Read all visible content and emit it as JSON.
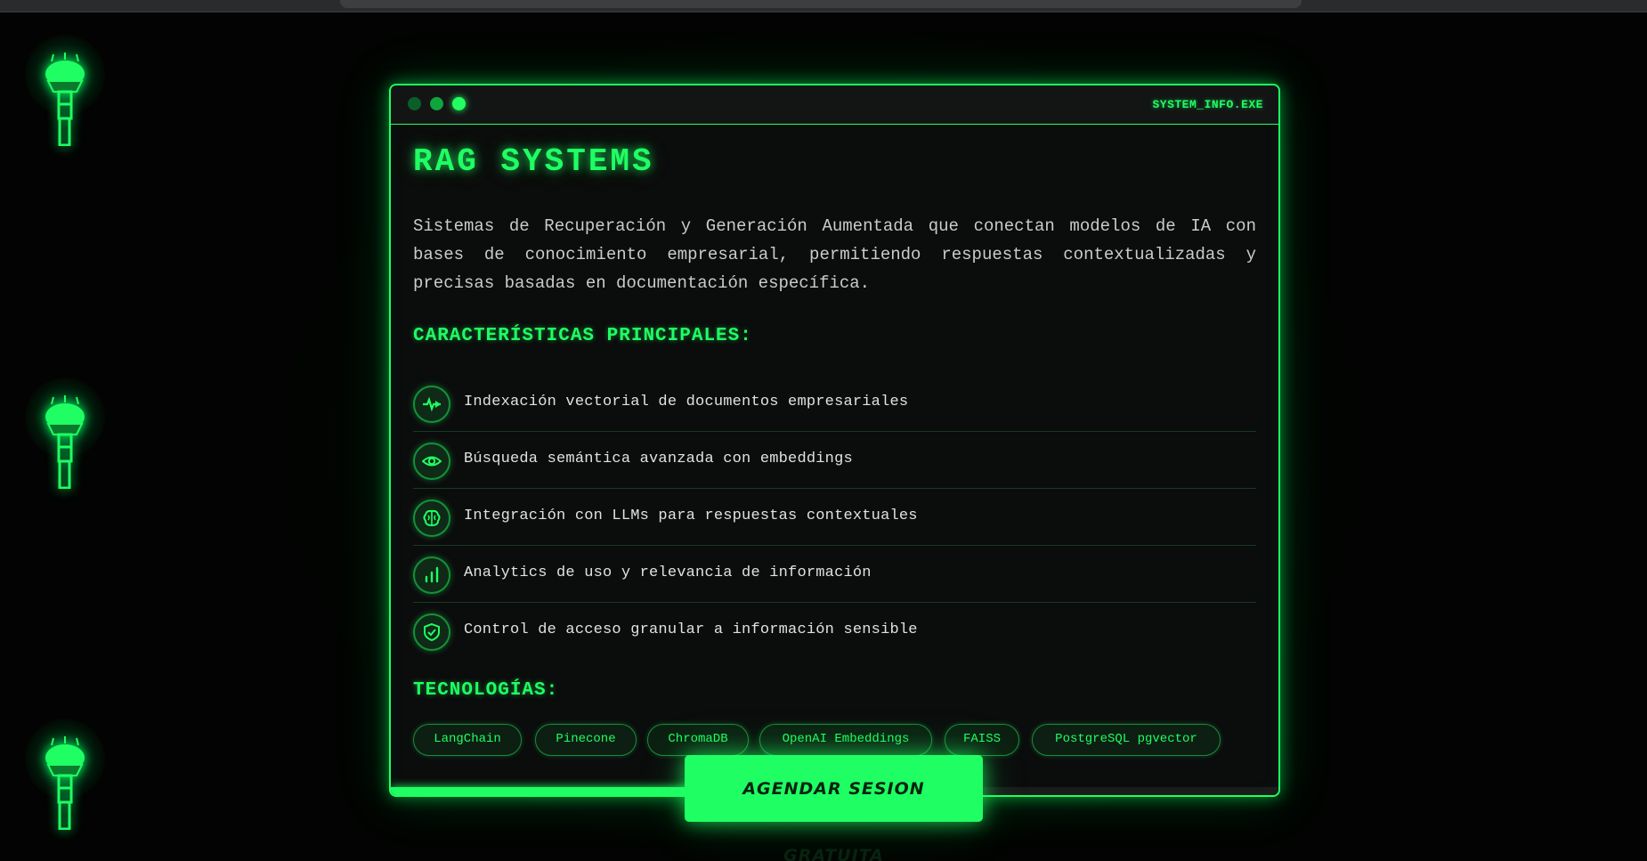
{
  "window": {
    "title": "SYSTEM_INFO.EXE"
  },
  "page": {
    "title": "RAG SYSTEMS",
    "description": "Sistemas de Recuperación y Generación Aumentada que conectan modelos de IA con bases de conocimiento empresarial, permitiendo respuestas contextualizadas y precisas basadas en documentación específica."
  },
  "features": {
    "heading": "CARACTERÍSTICAS PRINCIPALES:",
    "items": [
      {
        "label": "Indexación vectorial de documentos empresariales",
        "icon": "pulse-icon"
      },
      {
        "label": "Búsqueda semántica avanzada con embeddings",
        "icon": "eye-icon"
      },
      {
        "label": "Integración con LLMs para respuestas contextuales",
        "icon": "brain-icon"
      },
      {
        "label": "Analytics de uso y relevancia de información",
        "icon": "bar-chart-icon"
      },
      {
        "label": "Control de acceso granular a información sensible",
        "icon": "shield-check-icon"
      }
    ]
  },
  "technologies": {
    "heading": "TECNOLOGÍAS:",
    "tags": [
      "LangChain",
      "Pinecone",
      "ChromaDB",
      "OpenAI Embeddings",
      "FAISS",
      "PostgreSQL pgvector"
    ]
  },
  "progress": {
    "value_percent": 63
  },
  "cta": {
    "label": "AGENDAR SESION GRATUITA"
  },
  "colors": {
    "accent": "#1fff63",
    "background": "#020302",
    "panel": "#0b0c0c"
  }
}
